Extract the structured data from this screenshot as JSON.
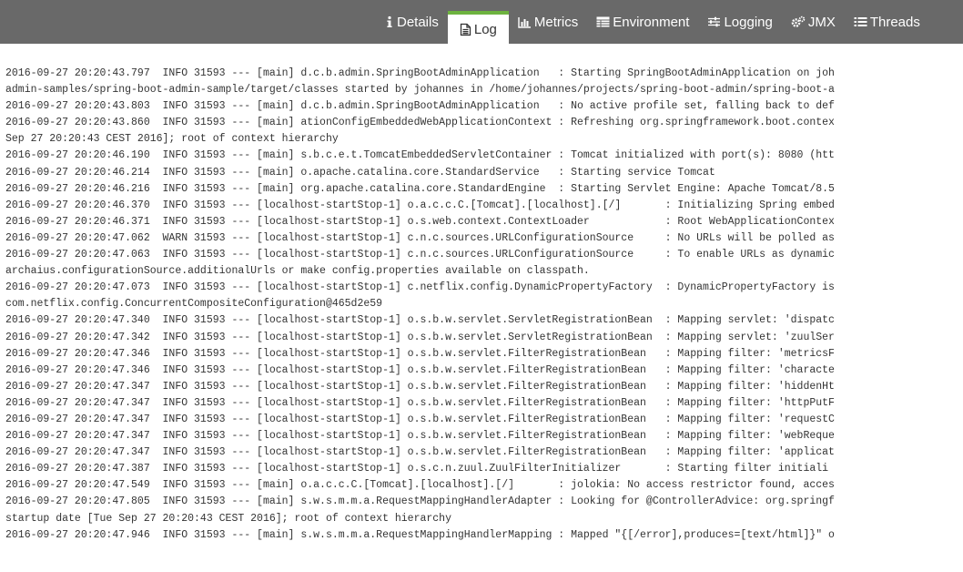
{
  "tabs": [
    {
      "label": "Details",
      "icon": "info-icon",
      "active": false
    },
    {
      "label": "Log",
      "icon": "file-text-icon",
      "active": true
    },
    {
      "label": "Metrics",
      "icon": "bar-chart-icon",
      "active": false
    },
    {
      "label": "Environment",
      "icon": "table-icon",
      "active": false
    },
    {
      "label": "Logging",
      "icon": "sliders-icon",
      "active": false
    },
    {
      "label": "JMX",
      "icon": "cogs-icon",
      "active": false
    },
    {
      "label": "Threads",
      "icon": "list-icon",
      "active": false
    }
  ],
  "colors": {
    "topbar": "#696969",
    "accent": "#6db33f",
    "text": "#333333"
  },
  "log": {
    "lines": [
      "2016-09-27 20:20:43.797  INFO 31593 --- [main] d.c.b.admin.SpringBootAdminApplication   : Starting SpringBootAdminApplication on joh",
      "admin-samples/spring-boot-admin-sample/target/classes started by johannes in /home/johannes/projects/spring-boot-admin/spring-boot-a",
      "2016-09-27 20:20:43.803  INFO 31593 --- [main] d.c.b.admin.SpringBootAdminApplication   : No active profile set, falling back to def",
      "2016-09-27 20:20:43.860  INFO 31593 --- [main] ationConfigEmbeddedWebApplicationContext : Refreshing org.springframework.boot.contex",
      "Sep 27 20:20:43 CEST 2016]; root of context hierarchy",
      "2016-09-27 20:20:46.190  INFO 31593 --- [main] s.b.c.e.t.TomcatEmbeddedServletContainer : Tomcat initialized with port(s): 8080 (htt",
      "2016-09-27 20:20:46.214  INFO 31593 --- [main] o.apache.catalina.core.StandardService   : Starting service Tomcat",
      "2016-09-27 20:20:46.216  INFO 31593 --- [main] org.apache.catalina.core.StandardEngine  : Starting Servlet Engine: Apache Tomcat/8.5",
      "2016-09-27 20:20:46.370  INFO 31593 --- [localhost-startStop-1] o.a.c.c.C.[Tomcat].[localhost].[/]       : Initializing Spring embed",
      "2016-09-27 20:20:46.371  INFO 31593 --- [localhost-startStop-1] o.s.web.context.ContextLoader            : Root WebApplicationContex",
      "2016-09-27 20:20:47.062  WARN 31593 --- [localhost-startStop-1] c.n.c.sources.URLConfigurationSource     : No URLs will be polled as",
      "2016-09-27 20:20:47.063  INFO 31593 --- [localhost-startStop-1] c.n.c.sources.URLConfigurationSource     : To enable URLs as dynamic",
      "archaius.configurationSource.additionalUrls or make config.properties available on classpath.",
      "2016-09-27 20:20:47.073  INFO 31593 --- [localhost-startStop-1] c.netflix.config.DynamicPropertyFactory  : DynamicPropertyFactory is",
      "com.netflix.config.ConcurrentCompositeConfiguration@465d2e59",
      "2016-09-27 20:20:47.340  INFO 31593 --- [localhost-startStop-1] o.s.b.w.servlet.ServletRegistrationBean  : Mapping servlet: 'dispatc",
      "2016-09-27 20:20:47.342  INFO 31593 --- [localhost-startStop-1] o.s.b.w.servlet.ServletRegistrationBean  : Mapping servlet: 'zuulSer",
      "2016-09-27 20:20:47.346  INFO 31593 --- [localhost-startStop-1] o.s.b.w.servlet.FilterRegistrationBean   : Mapping filter: 'metricsF",
      "2016-09-27 20:20:47.346  INFO 31593 --- [localhost-startStop-1] o.s.b.w.servlet.FilterRegistrationBean   : Mapping filter: 'characte",
      "2016-09-27 20:20:47.347  INFO 31593 --- [localhost-startStop-1] o.s.b.w.servlet.FilterRegistrationBean   : Mapping filter: 'hiddenHt",
      "2016-09-27 20:20:47.347  INFO 31593 --- [localhost-startStop-1] o.s.b.w.servlet.FilterRegistrationBean   : Mapping filter: 'httpPutF",
      "2016-09-27 20:20:47.347  INFO 31593 --- [localhost-startStop-1] o.s.b.w.servlet.FilterRegistrationBean   : Mapping filter: 'requestC",
      "2016-09-27 20:20:47.347  INFO 31593 --- [localhost-startStop-1] o.s.b.w.servlet.FilterRegistrationBean   : Mapping filter: 'webReque",
      "2016-09-27 20:20:47.347  INFO 31593 --- [localhost-startStop-1] o.s.b.w.servlet.FilterRegistrationBean   : Mapping filter: 'applicat",
      "2016-09-27 20:20:47.387  INFO 31593 --- [localhost-startStop-1] o.s.c.n.zuul.ZuulFilterInitializer       : Starting filter initiali",
      "2016-09-27 20:20:47.549  INFO 31593 --- [main] o.a.c.c.C.[Tomcat].[localhost].[/]       : jolokia: No access restrictor found, acces",
      "2016-09-27 20:20:47.805  INFO 31593 --- [main] s.w.s.m.m.a.RequestMappingHandlerAdapter : Looking for @ControllerAdvice: org.springf",
      "startup date [Tue Sep 27 20:20:43 CEST 2016]; root of context hierarchy",
      "2016-09-27 20:20:47.946  INFO 31593 --- [main] s.w.s.m.m.a.RequestMappingHandlerMapping : Mapped \"{[/error],produces=[text/html]}\" o"
    ]
  }
}
